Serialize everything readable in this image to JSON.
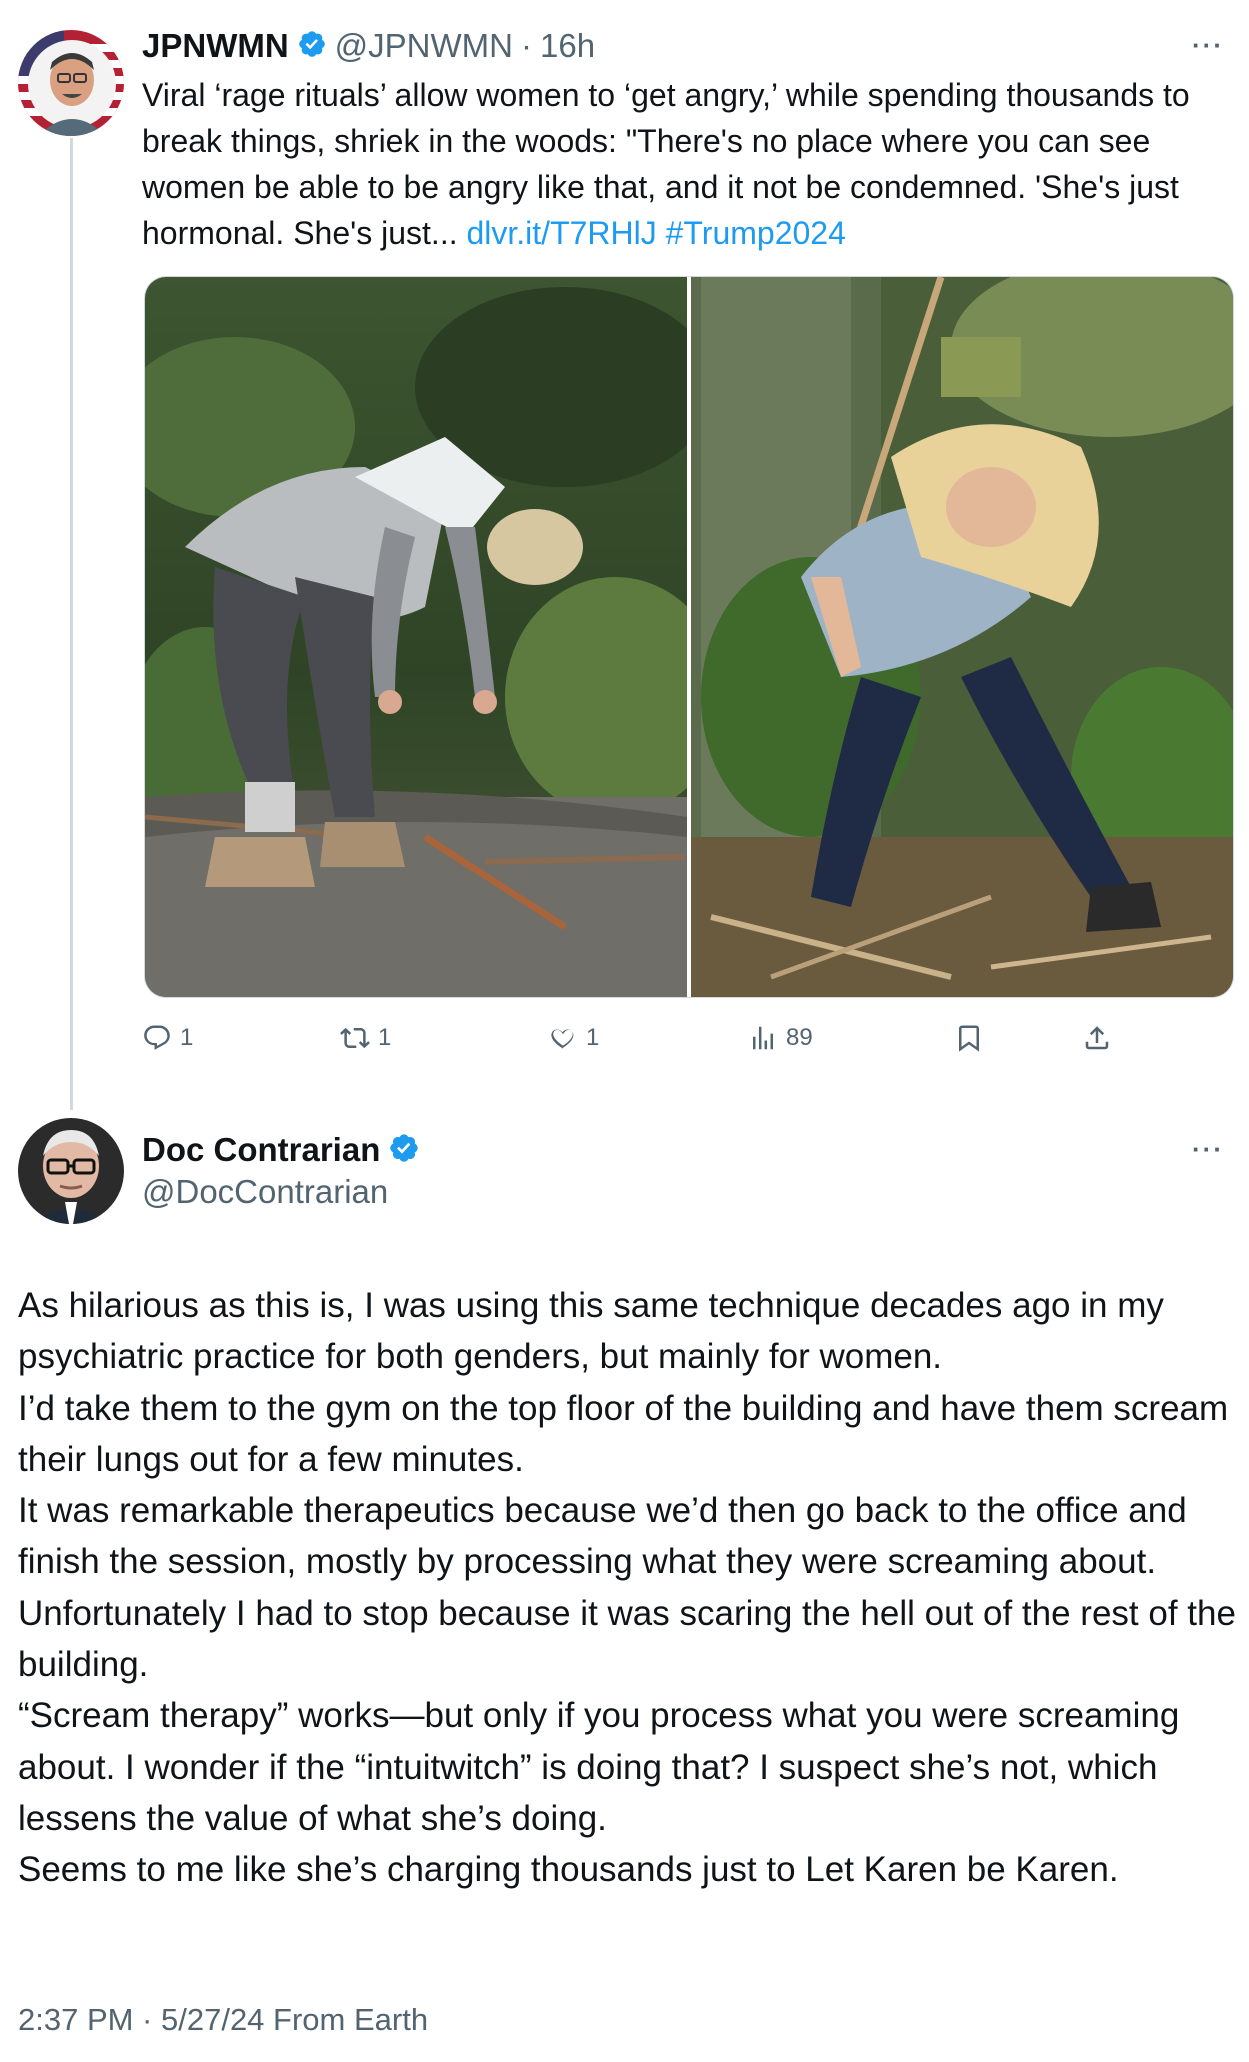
{
  "original_tweet": {
    "author_name": "JPNWMN",
    "author_handle": "@JPNWMN",
    "separator": "·",
    "time_ago": "16h",
    "more_icon": "more-horizontal-icon",
    "text": "Viral ‘rage rituals’ allow women to ‘get angry,’ while spending thousands to break things, shriek in the woods: \"There's no place where you can see women be able to be angry like that, and it not be condemned. 'She's just hormonal. She's just... ",
    "link": "dlvr.it/T7RHlJ",
    "hashtag": "#Trump2024",
    "actions": {
      "replies": "1",
      "reposts": "1",
      "likes": "1",
      "views": "89"
    }
  },
  "reply_tweet": {
    "author_name": "Doc Contrarian",
    "author_handle": "@DocContrarian",
    "more_icon": "more-horizontal-icon",
    "paragraphs": [
      "As hilarious as this is, I was using this same technique decades ago in my psychiatric practice for both genders, but mainly for women.",
      "I’d take them to the gym on the top floor of the building and have them scream their lungs out for a few minutes.",
      "It was remarkable therapeutics because we’d then go back to the office and finish the session, mostly by processing what they were screaming about.",
      "Unfortunately I had to stop because it was scaring the hell out of the rest of the building.",
      "“Scream therapy” works—but only if you process what you were screaming about. I wonder if the “intuitwitch” is doing that? I suspect she’s not, which lessens the value of what she’s doing.",
      "Seems to me like she’s charging thousands just to Let Karen be Karen."
    ],
    "footer": "2:37 PM · 5/27/24 From Earth"
  },
  "colors": {
    "link": "#1d9bf0",
    "verified": "#1d9bf0",
    "muted": "#536471",
    "text": "#0f1419"
  }
}
